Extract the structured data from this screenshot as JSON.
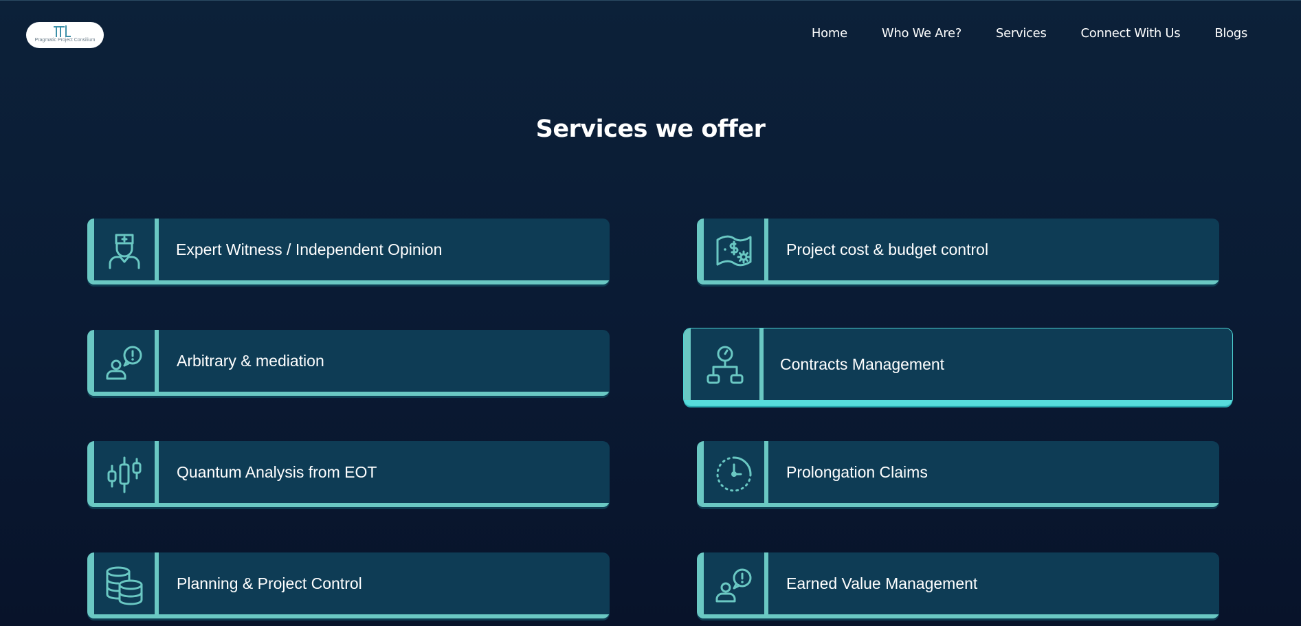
{
  "header": {
    "logo_text": "Pragmatic Project Consilium",
    "nav": [
      {
        "label": "Home"
      },
      {
        "label": "Who We Are?"
      },
      {
        "label": "Services"
      },
      {
        "label": "Connect With Us"
      },
      {
        "label": "Blogs"
      }
    ]
  },
  "main": {
    "title": "Services we offer",
    "services": [
      {
        "label": "Expert Witness / Independent Opinion",
        "icon": "expert-witness-icon"
      },
      {
        "label": "Project cost & budget control",
        "icon": "cost-budget-icon"
      },
      {
        "label": "Arbitrary & mediation",
        "icon": "mediation-icon"
      },
      {
        "label": "Contracts Management",
        "icon": "contracts-hierarchy-icon"
      },
      {
        "label": "Quantum Analysis from EOT",
        "icon": "candlestick-chart-icon"
      },
      {
        "label": "Prolongation Claims",
        "icon": "clock-timer-icon"
      },
      {
        "label": "Planning & Project Control",
        "icon": "database-icon"
      },
      {
        "label": "Earned Value Management",
        "icon": "mediation-icon"
      }
    ]
  },
  "colors": {
    "background": "#0c2139",
    "card": "#0e3c55",
    "accent": "#6ac8c3",
    "accent_active": "#57dcdc"
  }
}
